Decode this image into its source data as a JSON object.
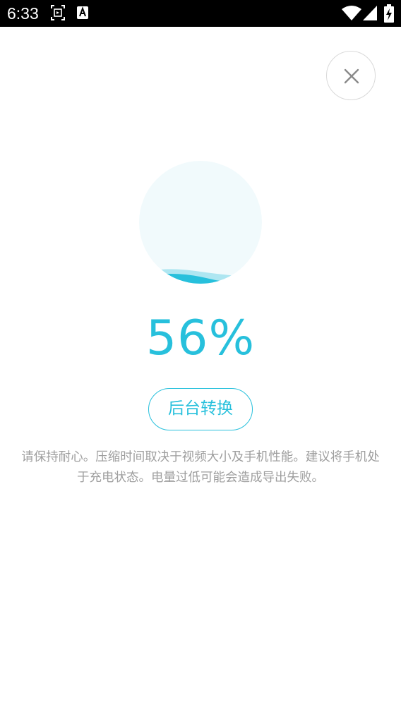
{
  "status_bar": {
    "time": "6:33",
    "icons": [
      "screenshot-icon",
      "a-icon",
      "wifi-icon",
      "signal-icon",
      "battery-charging-icon"
    ]
  },
  "close_button": {
    "icon": "close-icon"
  },
  "progress": {
    "percent_text": "56%",
    "fraction": 0.56,
    "color": "#27c0dc",
    "circle_bg": "#f1fafc"
  },
  "background_button": {
    "label": "后台转换"
  },
  "hint": {
    "text": "请保持耐心。压缩时间取决于视频大小及手机性能。建议将手机处于充电状态。电量过低可能会造成导出失败。"
  }
}
